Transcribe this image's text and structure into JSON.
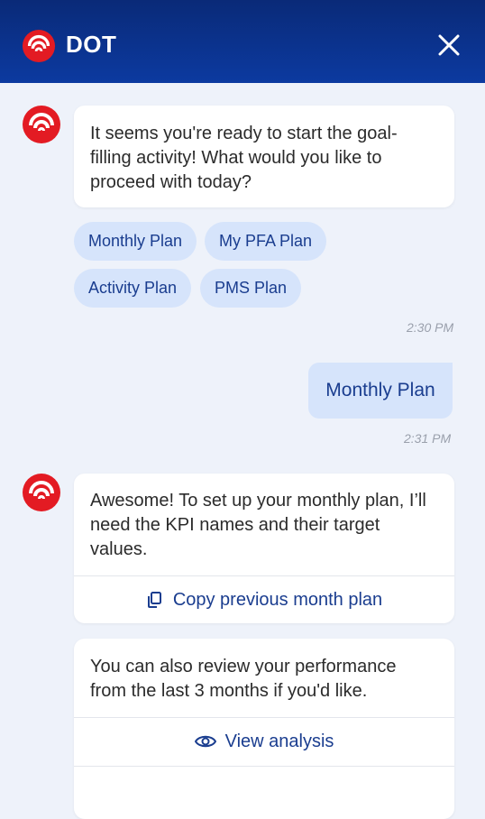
{
  "header": {
    "title": "DOT",
    "close_icon": "close-icon",
    "accent": "#0c3aa0"
  },
  "messages": {
    "bot1": "It seems you're ready to start the goal-filling activity! What would you like to proceed with today?",
    "chips": [
      "Monthly Plan",
      "My PFA Plan",
      "Activity Plan",
      "PMS Plan"
    ],
    "time1": "2:30 PM",
    "user1": "Monthly Plan",
    "time2": "2:31 PM",
    "bot2": "Awesome! To set up your monthly plan, I’ll need the KPI names and their target values.",
    "copy_action": "Copy previous month plan",
    "bot3": "You can also review your performance from the last 3 months if you'd like.",
    "view_action": "View analysis"
  }
}
